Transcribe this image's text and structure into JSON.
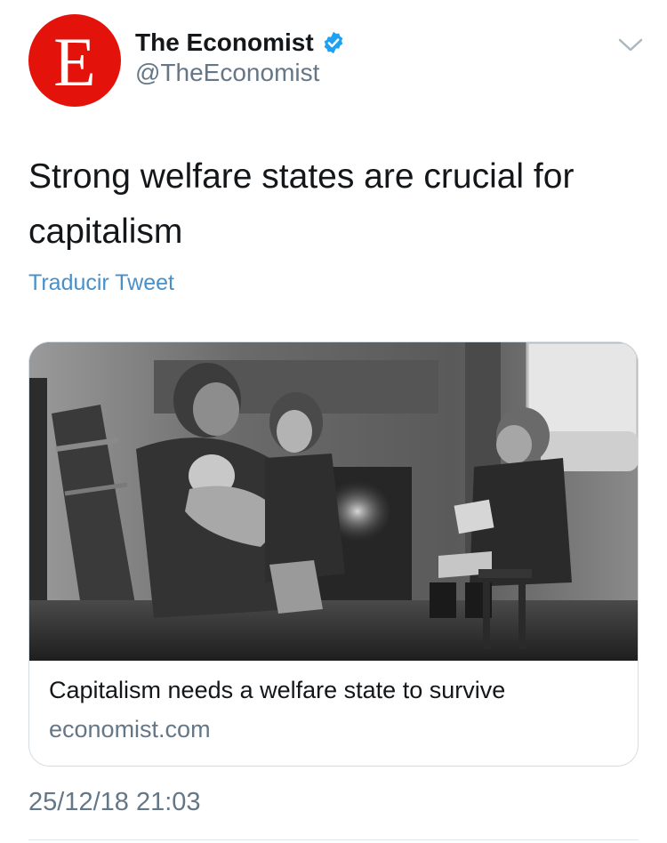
{
  "author": {
    "display_name": "The Economist",
    "handle": "@TheEconomist",
    "avatar_letter": "E",
    "avatar_color": "#e3120b",
    "verified": true
  },
  "tweet": {
    "text": "Strong welfare states are crucial for capitalism",
    "translate_label": "Traducir Tweet",
    "timestamp": "25/12/18 21:03"
  },
  "card": {
    "title": "Capitalism needs a welfare state to survive",
    "domain": "economist.com"
  },
  "icons": {
    "verified": "verified-badge-icon",
    "menu": "chevron-down-icon"
  },
  "colors": {
    "link": "#4a90c8",
    "secondary_text": "#657786",
    "verified_blue": "#1da1f2"
  }
}
